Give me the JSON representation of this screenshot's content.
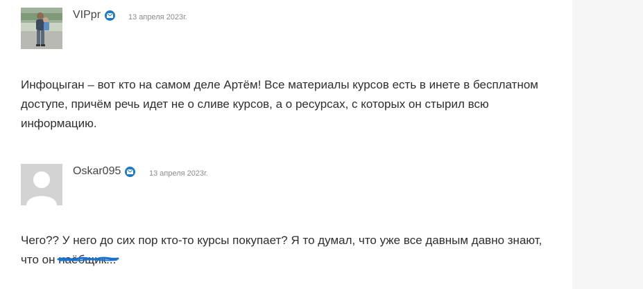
{
  "comments": [
    {
      "author": "VIPpr",
      "date": "13 апреля 2023г.",
      "avatar_icon": "user-photo-avatar",
      "text": "Инфоцыган – вот кто на самом деле Артём! Все материалы курсов есть в инете в бесплатном доступе, причём речь идет не о сливе курсов, а о ресурсах, с которых он стырил всю информацию."
    },
    {
      "author": "Oskar095",
      "date": "13 апреля 2023г.",
      "avatar_icon": "default-user-avatar",
      "text_main": "Чего?? У него до сих пор кто-то курсы покупает? Я то думал, что уже все давным давно знают, что он ",
      "text_scribbled": "наёбщик..."
    }
  ],
  "colors": {
    "mail_badge": "#1f7ac2",
    "scribble": "#1a73c9",
    "right_panel": "#f5f5f5"
  }
}
